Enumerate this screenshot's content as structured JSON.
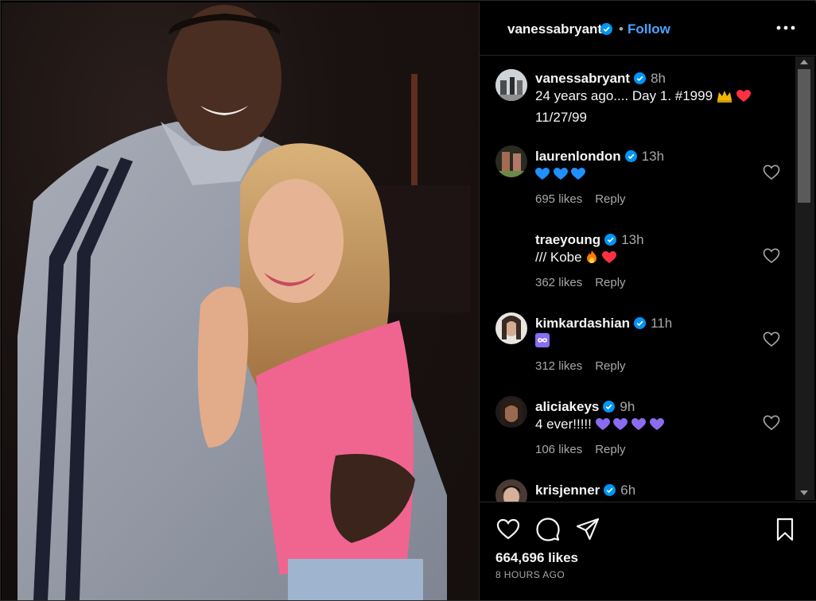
{
  "header": {
    "username": "vanessabryant",
    "separator": "•",
    "follow_label": "Follow"
  },
  "caption": {
    "username": "vanessabryant",
    "time": "8h",
    "text_line1": "24 years ago.... Day 1. #1999",
    "text_line2": "11/27/99"
  },
  "comments": [
    {
      "username": "laurenlondon",
      "time": "13h",
      "text": "",
      "likes": "695 likes",
      "reply": "Reply"
    },
    {
      "username": "traeyoung",
      "time": "13h",
      "text": "/// Kobe",
      "likes": "362 likes",
      "reply": "Reply"
    },
    {
      "username": "kimkardashian",
      "time": "11h",
      "text": "",
      "likes": "312 likes",
      "reply": "Reply"
    },
    {
      "username": "aliciakeys",
      "time": "9h",
      "text": "4 ever!!!!!",
      "likes": "106 likes",
      "reply": "Reply"
    },
    {
      "username": "krisjenner",
      "time": "6h",
      "text": "",
      "likes": "",
      "reply": ""
    }
  ],
  "footer": {
    "likes": "664,696 likes",
    "posted": "8 HOURS AGO"
  },
  "colors": {
    "accent": "#0095f6",
    "follow": "#4aa3ff",
    "verified": "#0095f6",
    "heart_red": "#ff3040",
    "blue_heart": "#1e90ff",
    "purple_heart": "#8a6cf0"
  },
  "icons": [
    "verified-icon",
    "more-icon",
    "heart-icon",
    "comment-icon",
    "share-icon",
    "bookmark-icon",
    "crown-icon",
    "fire-icon",
    "infinity-icon"
  ]
}
